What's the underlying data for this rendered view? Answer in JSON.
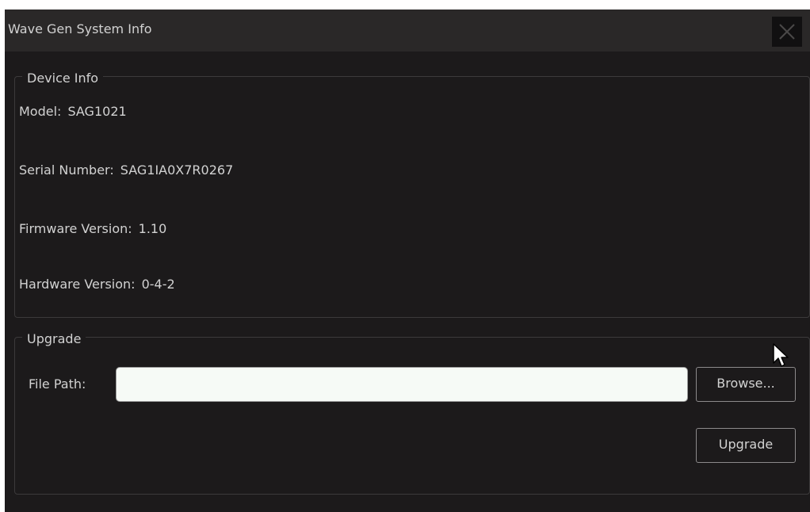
{
  "window": {
    "title": "Wave Gen System Info",
    "close_icon": "close-icon"
  },
  "device_info": {
    "legend": "Device Info",
    "model": {
      "label": "Model:",
      "value": "SAG1021"
    },
    "serial": {
      "label": "Serial Number:",
      "value": "SAG1IA0X7R0267"
    },
    "firmware": {
      "label": "Firmware Version:",
      "value": "1.10"
    },
    "hardware": {
      "label": "Hardware Version:",
      "value": "0-4-2"
    }
  },
  "upgrade": {
    "legend": "Upgrade",
    "file_path_label": "File Path:",
    "file_path_value": "",
    "browse_label": "Browse...",
    "upgrade_label": "Upgrade"
  },
  "colors": {
    "background": "#1c1a1b",
    "titlebar": "#2a2828",
    "text": "#d2d2d2",
    "border": "#3c3a3b",
    "input_bg": "#f6faf6"
  }
}
